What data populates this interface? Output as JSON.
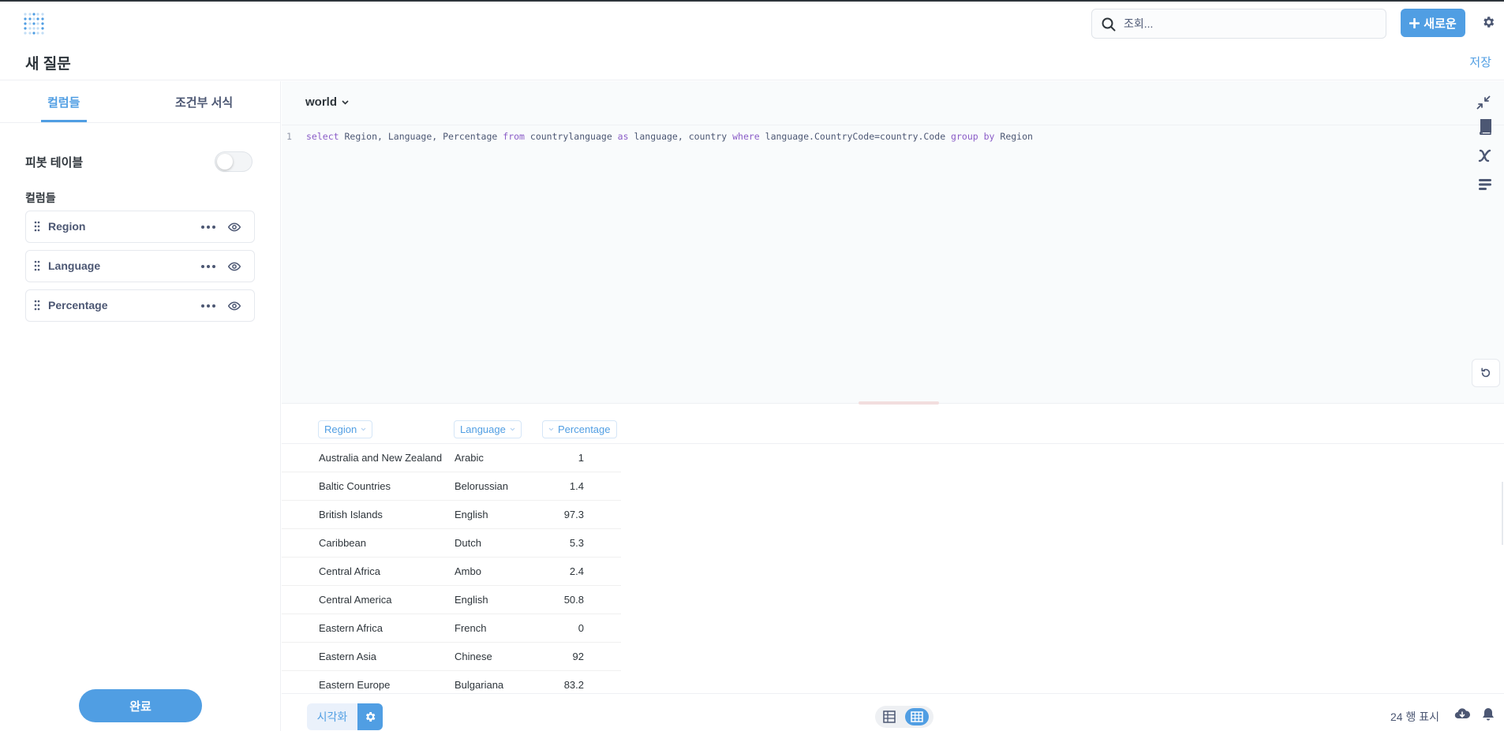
{
  "topbar": {
    "search_placeholder": "조회...",
    "new_button_label": "새로운"
  },
  "header": {
    "title": "새 질문",
    "save_label": "저장"
  },
  "sidebar": {
    "tabs": [
      {
        "label": "컬럼들",
        "active": true
      },
      {
        "label": "조건부 서식",
        "active": false
      }
    ],
    "pivot_label": "피봇 테이블",
    "pivot_enabled": false,
    "columns_label": "컬럼들",
    "columns": [
      {
        "name": "Region"
      },
      {
        "name": "Language"
      },
      {
        "name": "Percentage"
      }
    ],
    "done_label": "완료"
  },
  "editor": {
    "database": "world",
    "line_number": "1",
    "code_tokens": [
      {
        "text": "select",
        "kw": true
      },
      {
        "text": " Region, Language, Percentage ",
        "kw": false
      },
      {
        "text": "from",
        "kw": true
      },
      {
        "text": " countrylanguage ",
        "kw": false
      },
      {
        "text": "as",
        "kw": true
      },
      {
        "text": " language, country ",
        "kw": false
      },
      {
        "text": "where",
        "kw": true
      },
      {
        "text": " language.CountryCode=country.Code ",
        "kw": false
      },
      {
        "text": "group",
        "kw": true
      },
      {
        "text": " ",
        "kw": false
      },
      {
        "text": "by",
        "kw": true
      },
      {
        "text": " Region",
        "kw": false
      }
    ]
  },
  "results": {
    "headers": [
      "Region",
      "Language",
      "Percentage"
    ],
    "rows": [
      [
        "Australia and New Zealand",
        "Arabic",
        "1"
      ],
      [
        "Baltic Countries",
        "Belorussian",
        "1.4"
      ],
      [
        "British Islands",
        "English",
        "97.3"
      ],
      [
        "Caribbean",
        "Dutch",
        "5.3"
      ],
      [
        "Central Africa",
        "Ambo",
        "2.4"
      ],
      [
        "Central America",
        "English",
        "50.8"
      ],
      [
        "Eastern Africa",
        "French",
        "0"
      ],
      [
        "Eastern Asia",
        "Chinese",
        "92"
      ],
      [
        "Eastern Europe",
        "Bulgariana",
        "83.2"
      ]
    ]
  },
  "footer": {
    "visualize_label": "시각화",
    "row_count": "24 행 표시"
  },
  "colors": {
    "brand": "#509ee3",
    "text_dark": "#2e353b",
    "text_medium": "#4c5773",
    "keyword": "#8a5cc7"
  }
}
